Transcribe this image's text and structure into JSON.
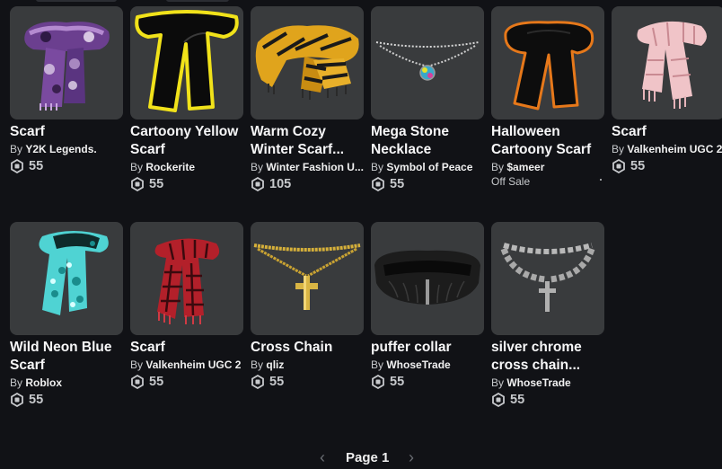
{
  "items": [
    {
      "name_line1": "Scarf",
      "name_line2": "",
      "creator_prefix": "By",
      "creator": "Y2K Legends.",
      "price": "55",
      "icon": "purple-scarf-thumbnail"
    },
    {
      "name_line1": "Cartoony Yellow",
      "name_line2": "Scarf",
      "creator_prefix": "By",
      "creator": "Rockerite",
      "price": "55",
      "icon": "yellow-cartoony-scarf-thumbnail"
    },
    {
      "name_line1": "Warm Cozy",
      "name_line2": "Winter Scarf...",
      "creator_prefix": "By",
      "creator": "Winter Fashion U...",
      "price": "105",
      "icon": "winter-scarf-thumbnail"
    },
    {
      "name_line1": "Mega Stone",
      "name_line2": "Necklace",
      "creator_prefix": "By",
      "creator": "Symbol of Peace",
      "price": "55",
      "icon": "stone-necklace-thumbnail"
    },
    {
      "name_line1": "Halloween",
      "name_line2": "Cartoony Scarf",
      "creator_prefix": "By",
      "creator": "$ameer",
      "price": "",
      "status": "Off Sale",
      "icon": "halloween-scarf-thumbnail"
    },
    {
      "name_line1": "Scarf",
      "name_line2": "",
      "creator_prefix": "By",
      "creator": "Valkenheim UGC 2",
      "price": "55",
      "icon": "pink-scarf-thumbnail"
    },
    {
      "name_line1": "Wild Neon Blue",
      "name_line2": "Scarf",
      "creator_prefix": "By",
      "creator": "Roblox",
      "price": "55",
      "icon": "neon-blue-scarf-thumbnail"
    },
    {
      "name_line1": "Scarf",
      "name_line2": "",
      "creator_prefix": "By",
      "creator": "Valkenheim UGC 2",
      "price": "55",
      "icon": "red-plaid-scarf-thumbnail"
    },
    {
      "name_line1": "Cross Chain",
      "name_line2": "",
      "creator_prefix": "By",
      "creator": "qliz",
      "price": "55",
      "icon": "gold-cross-chain-thumbnail"
    },
    {
      "name_line1": "puffer collar",
      "name_line2": "",
      "creator_prefix": "By",
      "creator": "WhoseTrade",
      "price": "55",
      "icon": "puffer-collar-thumbnail"
    },
    {
      "name_line1": "silver chrome",
      "name_line2": "cross chain...",
      "creator_prefix": "By",
      "creator": "WhoseTrade",
      "price": "55",
      "icon": "silver-cross-chain-thumbnail"
    }
  ],
  "pagination": {
    "label": "Page 1",
    "prev_icon": "chevron-left-icon",
    "next_icon": "chevron-right-icon"
  },
  "colors": {
    "background": "#111216",
    "card": "#393b3d",
    "text": "#f7f7f8",
    "muted": "#c7c9cc"
  }
}
